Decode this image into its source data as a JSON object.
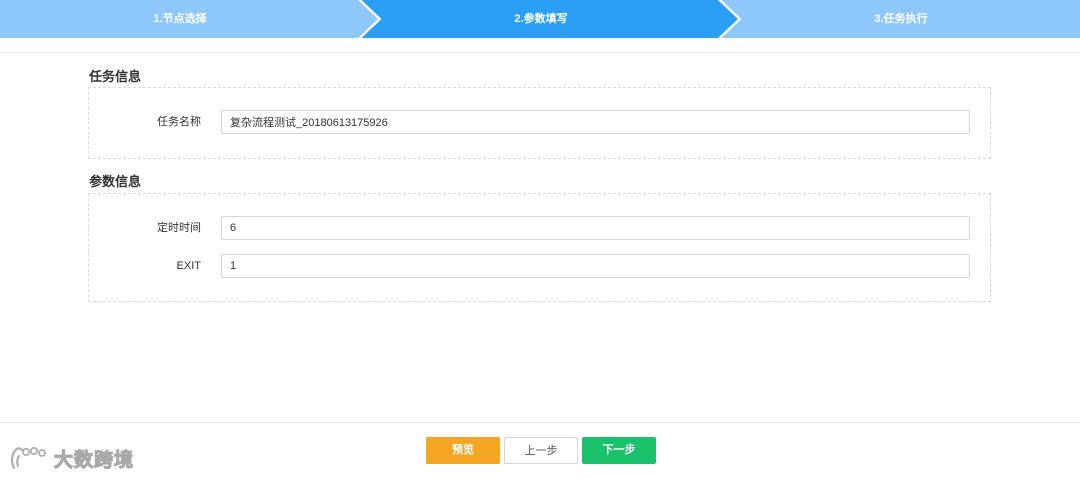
{
  "stepper": {
    "steps": [
      {
        "label": "1.节点选择",
        "state": "done"
      },
      {
        "label": "2.参数填写",
        "state": "active"
      },
      {
        "label": "3.任务执行",
        "state": "pending"
      }
    ],
    "colors": {
      "inactive": "#8ec8fb",
      "active": "#2b9ff6"
    }
  },
  "task_section": {
    "title": "任务信息",
    "fields": [
      {
        "label": "任务名称",
        "value": "复杂流程测试_20180613175926"
      }
    ]
  },
  "param_section": {
    "title": "参数信息",
    "fields": [
      {
        "label": "定时时间",
        "value": "6"
      },
      {
        "label": "EXIT",
        "value": "1"
      }
    ]
  },
  "actions": {
    "preview_label": "预览",
    "prev_label": "上一步",
    "next_label": "下一步",
    "colors": {
      "preview": "#f5a623",
      "next": "#19c26b"
    }
  },
  "watermark": {
    "text": "大数跨境",
    "icon": "brand-logo-icon"
  }
}
